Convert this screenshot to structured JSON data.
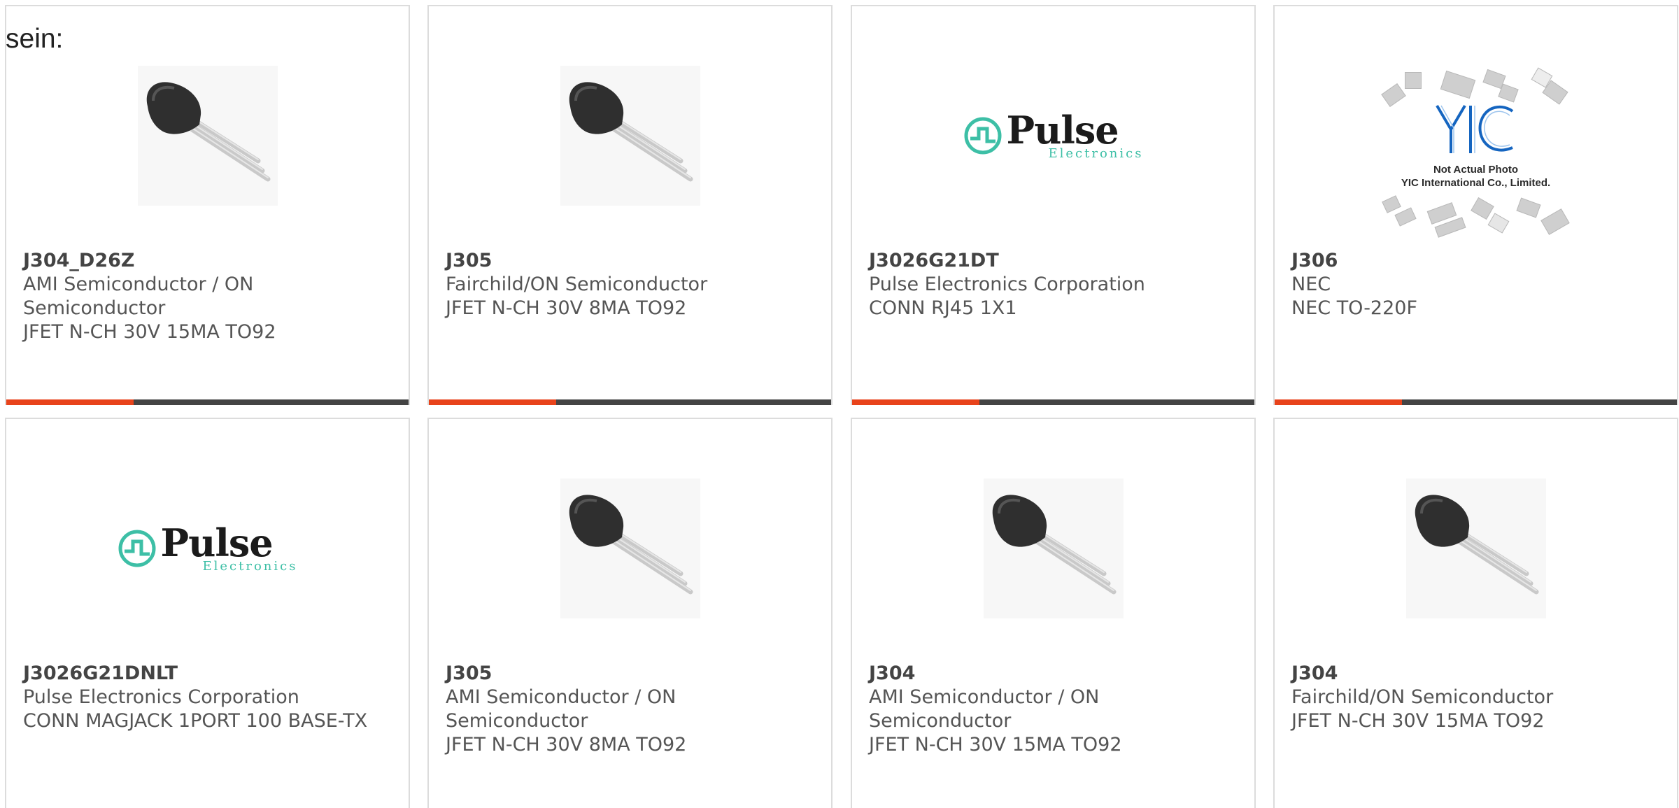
{
  "intro": {
    "text": "sein:"
  },
  "colors": {
    "accent": "#e8431b",
    "bar": "#444444",
    "pulse_teal": "#3dbfa6",
    "yic_blue": "#1565c0"
  },
  "products": [
    {
      "part": "J304_D26Z",
      "manufacturer": "AMI Semiconductor / ON Semiconductor",
      "description": "JFET N-CH 30V 15MA TO92",
      "image": "transistor-to92-icon"
    },
    {
      "part": "J305",
      "manufacturer": "Fairchild/ON Semiconductor",
      "description": "JFET N-CH 30V 8MA TO92",
      "image": "transistor-to92-icon"
    },
    {
      "part": "J3026G21DT",
      "manufacturer": "Pulse Electronics Corporation",
      "description": "CONN RJ45 1X1",
      "image": "pulse-electronics-logo"
    },
    {
      "part": "J306",
      "manufacturer": "NEC",
      "description": "NEC TO-220F",
      "image": "yic-not-actual-photo"
    },
    {
      "part": "J3026G21DNLT",
      "manufacturer": "Pulse Electronics Corporation",
      "description": "CONN MAGJACK 1PORT 100 BASE-TX",
      "image": "pulse-electronics-logo"
    },
    {
      "part": "J305",
      "manufacturer": "AMI Semiconductor / ON Semiconductor",
      "description": "JFET N-CH 30V 8MA TO92",
      "image": "transistor-to92-icon"
    },
    {
      "part": "J304",
      "manufacturer": "AMI Semiconductor / ON Semiconductor",
      "description": "JFET N-CH 30V 15MA TO92",
      "image": "transistor-to92-icon"
    },
    {
      "part": "J304",
      "manufacturer": "Fairchild/ON Semiconductor",
      "description": "JFET N-CH 30V 15MA TO92",
      "image": "transistor-to92-icon"
    }
  ],
  "logos": {
    "pulse": {
      "name": "Pulse",
      "sub": "Electronics"
    },
    "yic": {
      "mark": "YIC",
      "line1": "Not Actual Photo",
      "line2": "YIC International Co., Limited."
    }
  }
}
